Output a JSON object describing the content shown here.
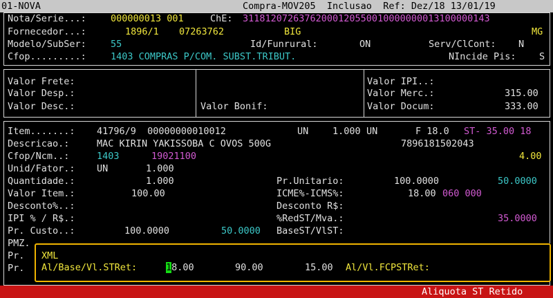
{
  "titlebar": {
    "left": "01-NOVA",
    "center": "Compra-MOV205  Inclusao  Ref: Dez/18 13/01/19"
  },
  "header": {
    "nota_label": "Nota/Serie...:",
    "nota_value": "000000013 001",
    "che_label": "ChE:",
    "che_value": "31181207263762000120550010000000013100000143",
    "fornecedor_label": "Fornecedor...:",
    "fornecedor_code": "1896/1",
    "fornecedor_cnpj": "07263762",
    "fornecedor_name": "BIG",
    "fornecedor_uf": "MG",
    "modelo_label": "Modelo/SubSer:",
    "modelo_value": "55",
    "funrural_label": "Id/Funrural:",
    "funrural_value": "ON",
    "servclcont_label": "Serv/ClCont:",
    "servclcont_value": "N",
    "cfop_label": "Cfop.........:",
    "cfop_value": "1403 COMPRAS P/COM. SUBST.TRIBUT.",
    "nincide_label": "NIncide Pis:",
    "nincide_value": "S"
  },
  "totals": {
    "frete_label": "Valor Frete:",
    "desp_label": "Valor Desp.:",
    "desc_label": "Valor Desc.:",
    "bonif_label": "Valor Bonif:",
    "ipi_label": "Valor IPI..:",
    "merc_label": "Valor Merc.:",
    "merc_value": "315.00",
    "docum_label": "Valor Docum:",
    "docum_value": "333.00"
  },
  "item": {
    "item_label": "Item.......:",
    "item_value": "41796/9  00000000010012",
    "un1": "UN",
    "qty1": "1.000",
    "un2": "UN",
    "f_value": "F 18.0",
    "st_value": "ST- 35.00 18",
    "descricao_label": "Descricao.:",
    "descricao_value": "MAC KIRIN YAKISSOBA C OVOS 500G",
    "ean": "7896181502043",
    "cfopncm_label": "Cfop/Ncm..:",
    "cfop": "1403",
    "ncm": "19021100",
    "ncm_extra": "4.00",
    "unid_label": "Unid/Fator.:",
    "unid_value": "UN",
    "fator_value": "1.000",
    "quantidade_label": "Quantidade.:",
    "quantidade_value": "1.000",
    "valoritem_label": "Valor Item.:",
    "valoritem_value": "100.00",
    "desconto_label": "Desconto%..:",
    "ipi_label": "IPI % / R$.:",
    "custo_label": "Pr. Custo..:",
    "custo_value": "100.0000",
    "custo_value2": "50.0000",
    "pmz_label": "PMZ.",
    "pr_label1": "Pr.",
    "pr_label2": "Pr.",
    "unitario_label": "Pr.Unitario:",
    "unitario_value": "100.0000",
    "unitario_value2": "50.0000",
    "icme_label": "ICME%-ICMS%:",
    "icme_value": "18.00",
    "icme_extra": "060 000",
    "descontors_label": "Desconto R$:",
    "redst_label": "%RedST/Mva.:",
    "redst_value": "35.0000",
    "basest_label": "BaseST/VlST:"
  },
  "xml_panel": {
    "title": "XML",
    "alstret_label": "Al/Base/Vl.STRet:",
    "alstret_cursor": "1",
    "alstret_value": "8.00",
    "base_value": "90.00",
    "vl_value": "15.00",
    "fcp_label": "Al/Vl.FCPSTRet:"
  },
  "status": {
    "text": "Aliquota ST Retido"
  }
}
